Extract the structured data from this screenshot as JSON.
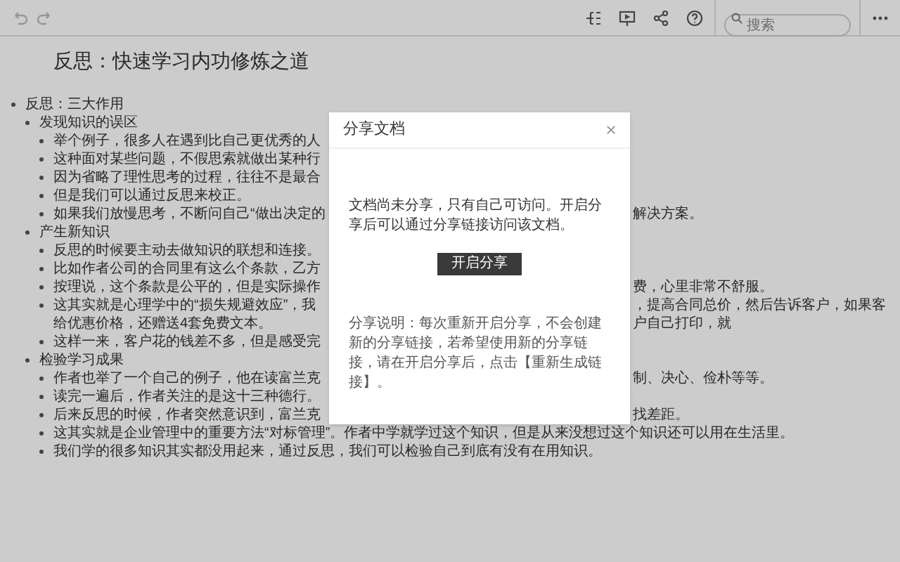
{
  "toolbar": {
    "search": {
      "placeholder": "搜索"
    }
  },
  "document": {
    "title": "反思：快速学习内功修炼之道",
    "outline": [
      {
        "text": "反思：三大作用",
        "children": [
          {
            "text": "发现知识的误区",
            "children": [
              {
                "text": "举个例子，很多人在遇到比自己更优秀的人"
              },
              {
                "text": "这种面对某些问题，不假思索就做出某种行"
              },
              {
                "text": "因为省略了理性思考的过程，往往不是最合"
              },
              {
                "text": "但是我们可以通过反思来校正。"
              },
              {
                "text": "如果我们放慢思考，不断问自己“做出决定的",
                "text_after": "解决方案。"
              }
            ]
          },
          {
            "text": "产生新知识",
            "children": [
              {
                "text": "反思的时候要主动去做知识的联想和连接。"
              },
              {
                "text": "比如作者公司的合同里有这么个条款，乙方"
              },
              {
                "text": "按理说，这个条款是公平的，但是实际操作",
                "text_after": "费，心里非常不舒服。"
              },
              {
                "text": "这其实就是心理学中的“损失规避效应”，我",
                "continuation": "给优惠价格，还赠送4套免费文本。",
                "text_after": "，提高合同总价，然后告诉客户，如果客户自己打印，就"
              },
              {
                "text": "这样一来，客户花的钱差不多，但是感受完"
              }
            ]
          },
          {
            "text": "检验学习成果",
            "children": [
              {
                "text": "作者也举了一个自己的例子，他在读富兰克",
                "text_after": "制、决心、俭朴等等。"
              },
              {
                "text": "读完一遍后，作者关注的是这十三种德行。"
              },
              {
                "text": "后来反思的时候，作者突然意识到，富兰克",
                "text_after": "找差距。"
              },
              {
                "text": "这其实就是企业管理中的重要方法“对标管理”。作者中学就学过这个知识，但是从来没想过这个知识还可以用在生活里。"
              },
              {
                "text": "我们学的很多知识其实都没用起来，通过反思，我们可以检验自己到底有没有在用知识。"
              }
            ]
          }
        ]
      }
    ]
  },
  "dialog": {
    "title": "分享文档",
    "message": "文档尚未分享，只有自己可访问。开启分享后可以通过分享链接访问该文档。",
    "button": "开启分享",
    "note": "分享说明：每次重新开启分享，不会创建新的分享链接，若希望使用新的分享链接，请在开启分享后，点击【重新生成链接】。"
  }
}
